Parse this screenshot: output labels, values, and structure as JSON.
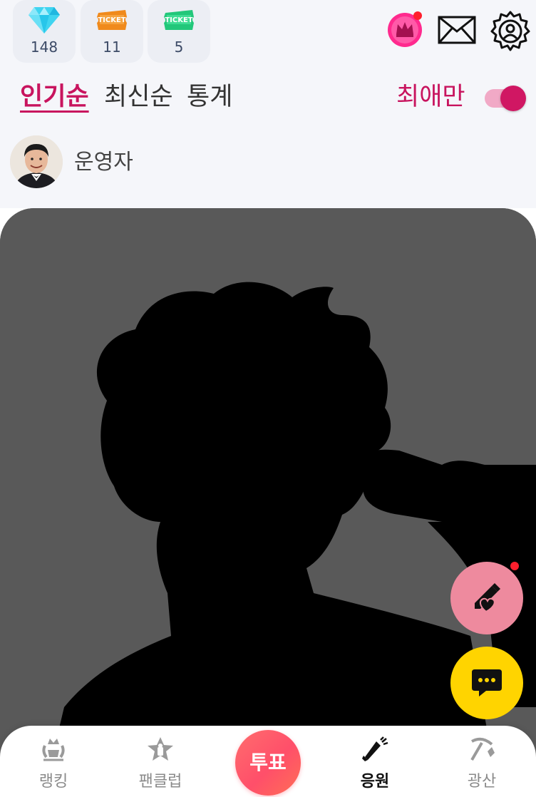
{
  "currencies": [
    {
      "name": "diamond",
      "icon": "diamond-icon",
      "count": "148"
    },
    {
      "name": "orange-ticket",
      "icon": "orange-ticket-icon",
      "label": "TICKET",
      "count": "11"
    },
    {
      "name": "green-ticket",
      "icon": "green-ticket-icon",
      "label": "TICKET",
      "count": "5"
    }
  ],
  "header_icons": [
    "crown-badge-icon",
    "mail-icon",
    "settings-user-icon"
  ],
  "sort_tabs": [
    {
      "label": "인기순",
      "active": true
    },
    {
      "label": "최신순",
      "active": false
    },
    {
      "label": "통계",
      "active": false
    }
  ],
  "favorites_only": {
    "label": "최애만",
    "on": true
  },
  "profile": {
    "name": "운영자"
  },
  "floating_buttons": [
    "write-heart-icon",
    "chat-icon"
  ],
  "bottom_nav": [
    {
      "label": "랭킹",
      "icon": "laurel-crown-icon",
      "active": false
    },
    {
      "label": "팬클럽",
      "icon": "fanclub-star-icon",
      "active": false
    },
    {
      "label": "투표",
      "center": true
    },
    {
      "label": "응원",
      "icon": "megaphone-icon",
      "active": true
    },
    {
      "label": "광산",
      "icon": "pickaxe-icon",
      "active": false
    }
  ],
  "colors": {
    "accent": "#c8145e",
    "vote_gradient": [
      "#ff6d6d",
      "#ff6e55"
    ],
    "chat_yellow": "#ffd400",
    "write_pink": "#ee8a9e"
  }
}
